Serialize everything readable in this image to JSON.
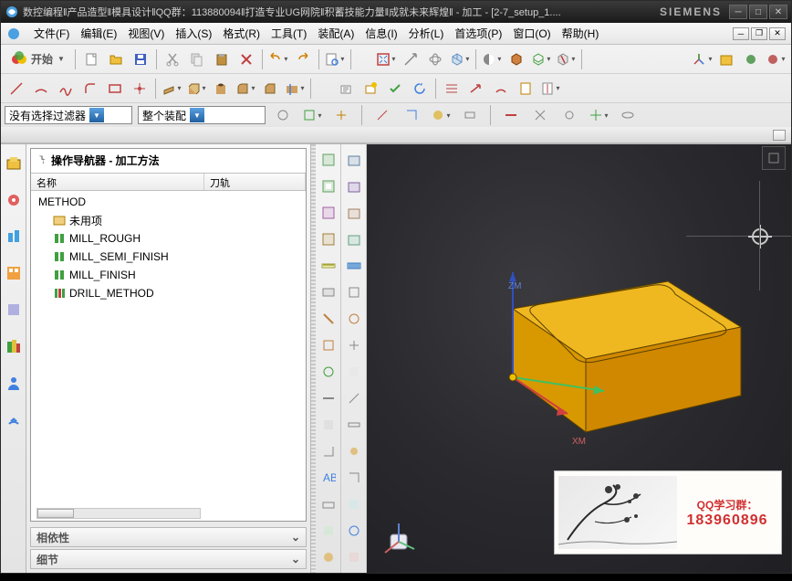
{
  "window": {
    "title": "数控编程‖产品造型‖模具设计‖QQ群：113880094‖打造专业UG网院‖积蓄技能力量‖成就未来辉煌‖ - 加工 - [2-7_setup_1....",
    "brand": "SIEMENS"
  },
  "menubar": [
    "文件(F)",
    "编辑(E)",
    "视图(V)",
    "插入(S)",
    "格式(R)",
    "工具(T)",
    "装配(A)",
    "信息(I)",
    "分析(L)",
    "首选项(P)",
    "窗口(O)",
    "帮助(H)"
  ],
  "toolbar": {
    "start_label": "开始"
  },
  "filter": {
    "selection": "没有选择过滤器",
    "scope": "整个装配"
  },
  "navigator": {
    "title": "操作导航器 - 加工方法",
    "columns": {
      "name": "名称",
      "toolpath": "刀轨"
    },
    "root": "METHOD",
    "items": [
      "未用项",
      "MILL_ROUGH",
      "MILL_SEMI_FINISH",
      "MILL_FINISH",
      "DRILL_METHOD"
    ],
    "sections": {
      "deps": "相依性",
      "detail": "细节"
    }
  },
  "viewport": {
    "axis_x": "XM",
    "axis_z": "ZM"
  },
  "watermark": {
    "line1": "QQ学习群：",
    "line2": "183960896"
  }
}
